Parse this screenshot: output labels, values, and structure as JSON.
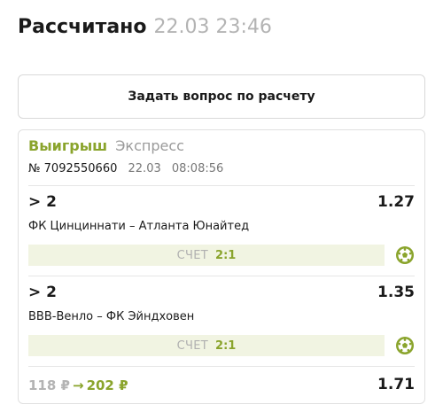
{
  "header": {
    "status": "Рассчитано",
    "datetime": "22.03 23:46"
  },
  "ask_button": {
    "label": "Задать вопрос по расчету"
  },
  "bet": {
    "result": "Выигрыш",
    "type": "Экспресс",
    "ticket_number": "№ 7092550660",
    "date": "22.03",
    "time": "08:08:56",
    "events": [
      {
        "market": "> 2",
        "odds": "1.27",
        "teams": "ФК Цинциннати – Атланта Юнайтед",
        "score_label": "СЧЕТ",
        "score": "2:1",
        "sport_icon": "soccer-ball-icon"
      },
      {
        "market": "> 2",
        "odds": "1.35",
        "teams": "ВВВ-Венло – ФК Эйндховен",
        "score_label": "СЧЕТ",
        "score": "2:1",
        "sport_icon": "soccer-ball-icon"
      }
    ],
    "stake": "118 ₽",
    "arrow": "→",
    "payout": "202 ₽",
    "total_odds": "1.71"
  },
  "colors": {
    "accent": "#8aa42c",
    "score_bg": "#f1f4e2",
    "muted": "#b3b3b3"
  }
}
